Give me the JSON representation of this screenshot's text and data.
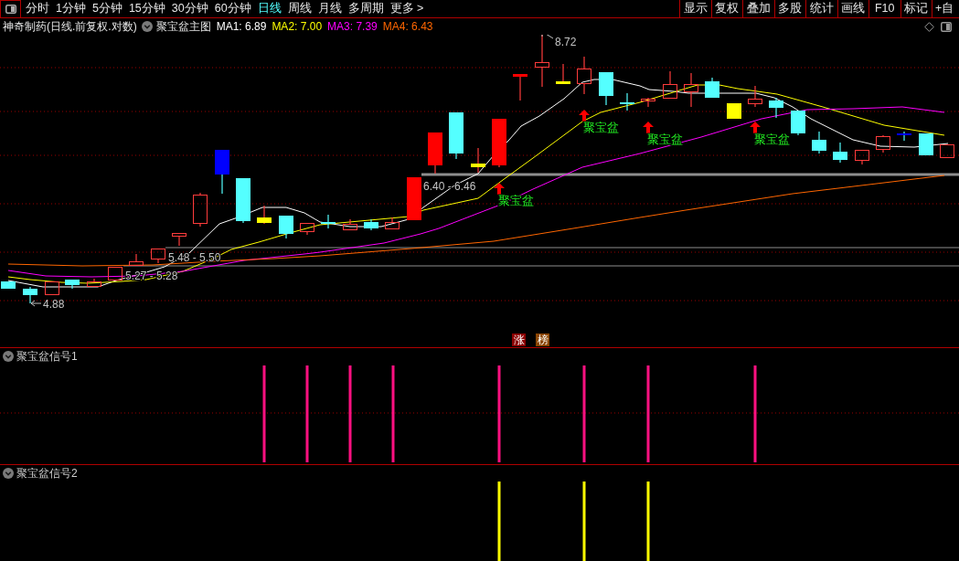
{
  "toolbar": {
    "period_tabs": [
      {
        "label": "分时",
        "selected": false
      },
      {
        "label": "1分钟",
        "selected": false
      },
      {
        "label": "5分钟",
        "selected": false
      },
      {
        "label": "15分钟",
        "selected": false
      },
      {
        "label": "30分钟",
        "selected": false
      },
      {
        "label": "60分钟",
        "selected": false
      },
      {
        "label": "日线",
        "selected": true
      },
      {
        "label": "周线",
        "selected": false
      },
      {
        "label": "月线",
        "selected": false
      },
      {
        "label": "多周期",
        "selected": false
      },
      {
        "label": "更多 >",
        "selected": false
      }
    ],
    "tool_buttons": [
      {
        "label": "显示"
      },
      {
        "label": "复权"
      },
      {
        "label": "叠加"
      },
      {
        "label": "多股"
      },
      {
        "label": "统计"
      },
      {
        "label": "画线"
      },
      {
        "label": "F10"
      },
      {
        "label": "标记"
      },
      {
        "label": "+自"
      }
    ]
  },
  "chart_header": {
    "title": "神奇制药(日线.前复权.对数)",
    "indicator": "聚宝盆主图",
    "moving_averages": [
      {
        "label": "MA1: 6.89",
        "color": "#ffffff"
      },
      {
        "label": "MA2: 7.00",
        "color": "#ffff00"
      },
      {
        "label": "MA3: 7.39",
        "color": "#ff00ff"
      },
      {
        "label": "MA4: 6.43",
        "color": "#ff6600"
      }
    ]
  },
  "main_chart": {
    "high_label": "8.72",
    "low_label": "4.88",
    "range_labels": [
      "6.40 - 6.46",
      "5.48 - 5.50",
      "5.27 - 5.28"
    ],
    "signal_labels": [
      "聚宝盆",
      "聚宝盆",
      "聚宝盆",
      "聚宝盆"
    ]
  },
  "badges": [
    {
      "label": "涨",
      "color": "#8b0000"
    },
    {
      "label": "榜",
      "color": "#8b4500"
    }
  ],
  "panels": [
    {
      "title": "聚宝盆信号1"
    },
    {
      "title": "聚宝盆信号2"
    }
  ]
}
